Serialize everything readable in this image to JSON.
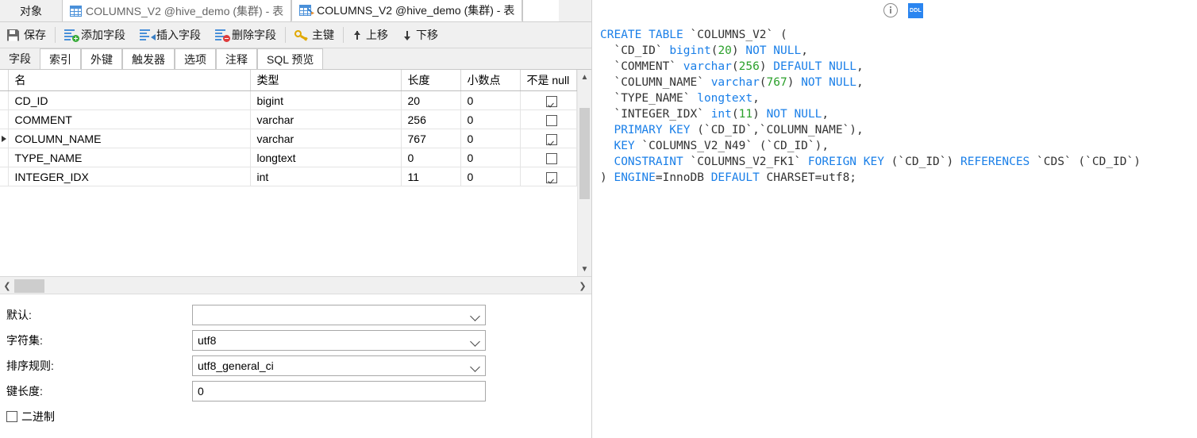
{
  "window": {
    "object_label": "对象",
    "tabs": [
      {
        "label": "COLUMNS_V2 @hive_demo (集群) - 表",
        "icon": "grid-icon",
        "active": false
      },
      {
        "label": "COLUMNS_V2 @hive_demo (集群) - 表",
        "icon": "grid-pencil-icon",
        "active": true
      }
    ]
  },
  "toolbar": {
    "save": "保存",
    "add_field": "添加字段",
    "insert_field": "插入字段",
    "delete_field": "删除字段",
    "primary_key": "主键",
    "move_up": "上移",
    "move_down": "下移"
  },
  "subtabs": [
    {
      "label": "字段",
      "active": true
    },
    {
      "label": "索引",
      "active": false
    },
    {
      "label": "外键",
      "active": false
    },
    {
      "label": "触发器",
      "active": false
    },
    {
      "label": "选项",
      "active": false
    },
    {
      "label": "注释",
      "active": false
    },
    {
      "label": "SQL 预览",
      "active": false
    }
  ],
  "grid": {
    "headers": [
      "名",
      "类型",
      "长度",
      "小数点",
      "不是 null"
    ],
    "rows": [
      {
        "selected": false,
        "name": "CD_ID",
        "type": "bigint",
        "length": "20",
        "decimals": "0",
        "not_null": true
      },
      {
        "selected": false,
        "name": "COMMENT",
        "type": "varchar",
        "length": "256",
        "decimals": "0",
        "not_null": false
      },
      {
        "selected": true,
        "name": "COLUMN_NAME",
        "type": "varchar",
        "length": "767",
        "decimals": "0",
        "not_null": true
      },
      {
        "selected": false,
        "name": "TYPE_NAME",
        "type": "longtext",
        "length": "0",
        "decimals": "0",
        "not_null": false
      },
      {
        "selected": false,
        "name": "INTEGER_IDX",
        "type": "int",
        "length": "11",
        "decimals": "0",
        "not_null": true
      }
    ]
  },
  "form": {
    "default_label": "默认:",
    "default_value": "",
    "charset_label": "字符集:",
    "charset_value": "utf8",
    "collation_label": "排序规则:",
    "collation_value": "utf8_general_ci",
    "key_length_label": "键长度:",
    "key_length_value": "0",
    "binary_label": "二进制",
    "binary_checked": false
  },
  "sql_panel": {
    "info_icon": "info-icon",
    "ddl_icon": "ddl-icon",
    "ddl_label": "DDL",
    "lines": [
      [
        {
          "t": "CREATE TABLE ",
          "c": "kw"
        },
        {
          "t": "`COLUMNS_V2` (",
          "c": "ident"
        }
      ],
      [
        {
          "t": "  `CD_ID` ",
          "c": "ident"
        },
        {
          "t": "bigint",
          "c": "kw"
        },
        {
          "t": "(",
          "c": "ident"
        },
        {
          "t": "20",
          "c": "num"
        },
        {
          "t": ") ",
          "c": "ident"
        },
        {
          "t": "NOT NULL",
          "c": "kw"
        },
        {
          "t": ",",
          "c": "ident"
        }
      ],
      [
        {
          "t": "  `COMMENT` ",
          "c": "ident"
        },
        {
          "t": "varchar",
          "c": "kw"
        },
        {
          "t": "(",
          "c": "ident"
        },
        {
          "t": "256",
          "c": "num"
        },
        {
          "t": ") ",
          "c": "ident"
        },
        {
          "t": "DEFAULT NULL",
          "c": "kw"
        },
        {
          "t": ",",
          "c": "ident"
        }
      ],
      [
        {
          "t": "  `COLUMN_NAME` ",
          "c": "ident"
        },
        {
          "t": "varchar",
          "c": "kw"
        },
        {
          "t": "(",
          "c": "ident"
        },
        {
          "t": "767",
          "c": "num"
        },
        {
          "t": ") ",
          "c": "ident"
        },
        {
          "t": "NOT NULL",
          "c": "kw"
        },
        {
          "t": ",",
          "c": "ident"
        }
      ],
      [
        {
          "t": "  `TYPE_NAME` ",
          "c": "ident"
        },
        {
          "t": "longtext",
          "c": "kw"
        },
        {
          "t": ",",
          "c": "ident"
        }
      ],
      [
        {
          "t": "  `INTEGER_IDX` ",
          "c": "ident"
        },
        {
          "t": "int",
          "c": "kw"
        },
        {
          "t": "(",
          "c": "ident"
        },
        {
          "t": "11",
          "c": "num"
        },
        {
          "t": ") ",
          "c": "ident"
        },
        {
          "t": "NOT NULL",
          "c": "kw"
        },
        {
          "t": ",",
          "c": "ident"
        }
      ],
      [
        {
          "t": "  ",
          "c": "ident"
        },
        {
          "t": "PRIMARY KEY",
          "c": "kw"
        },
        {
          "t": " (`CD_ID`,`COLUMN_NAME`),",
          "c": "ident"
        }
      ],
      [
        {
          "t": "  ",
          "c": "ident"
        },
        {
          "t": "KEY",
          "c": "kw"
        },
        {
          "t": " `COLUMNS_V2_N49` (`CD_ID`),",
          "c": "ident"
        }
      ],
      [
        {
          "t": "  ",
          "c": "ident"
        },
        {
          "t": "CONSTRAINT",
          "c": "kw"
        },
        {
          "t": " `COLUMNS_V2_FK1` ",
          "c": "ident"
        },
        {
          "t": "FOREIGN KEY",
          "c": "kw"
        },
        {
          "t": " (`CD_ID`) ",
          "c": "ident"
        },
        {
          "t": "REFERENCES",
          "c": "kw"
        },
        {
          "t": " `CDS` (`CD_ID`)",
          "c": "ident"
        }
      ],
      [
        {
          "t": ") ",
          "c": "ident"
        },
        {
          "t": "ENGINE",
          "c": "kw"
        },
        {
          "t": "=InnoDB ",
          "c": "ident"
        },
        {
          "t": "DEFAULT",
          "c": "kw"
        },
        {
          "t": " CHARSET=utf8;",
          "c": "ident"
        }
      ]
    ]
  },
  "colors": {
    "keyword": "#1a7fe8",
    "number": "#2ca02c",
    "chrome": "#f0f0f0",
    "accent": "#2a85f0"
  }
}
